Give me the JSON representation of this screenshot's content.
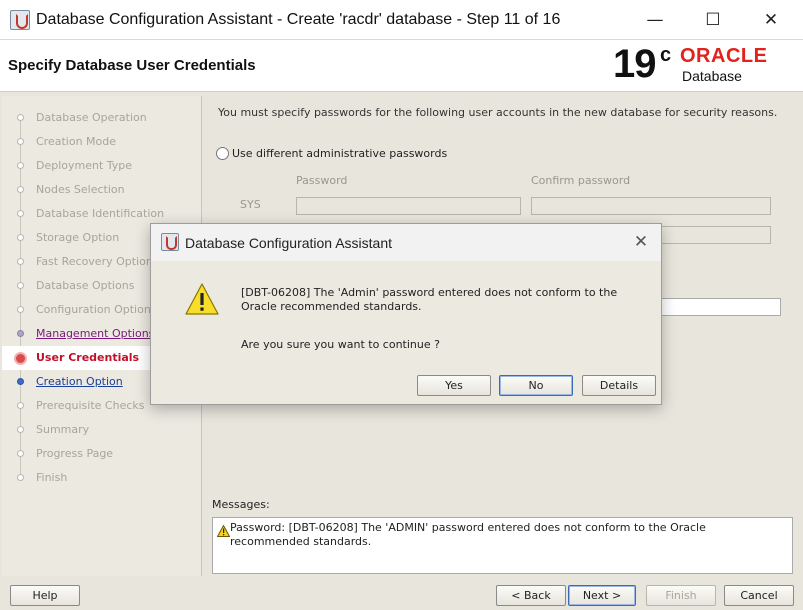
{
  "window": {
    "title": "Database Configuration Assistant - Create 'racdr' database - Step 11 of 16",
    "minimize": "—",
    "maximize": "☐",
    "close": "✕"
  },
  "header": {
    "page_title": "Specify Database User Credentials",
    "brand_version": "19",
    "brand_version_suffix": "c",
    "brand_name": "ORACLE",
    "brand_product": "Database"
  },
  "nav": {
    "steps": [
      {
        "label": "Database Operation",
        "state": "disabled"
      },
      {
        "label": "Creation Mode",
        "state": "disabled"
      },
      {
        "label": "Deployment Type",
        "state": "disabled"
      },
      {
        "label": "Nodes Selection",
        "state": "disabled"
      },
      {
        "label": "Database Identification",
        "state": "disabled"
      },
      {
        "label": "Storage Option",
        "state": "disabled"
      },
      {
        "label": "Fast Recovery Option",
        "state": "disabled"
      },
      {
        "label": "Database Options",
        "state": "disabled"
      },
      {
        "label": "Configuration Options",
        "state": "disabled"
      },
      {
        "label": "Management Options",
        "state": "done"
      },
      {
        "label": "User Credentials",
        "state": "current"
      },
      {
        "label": "Creation Option",
        "state": "next"
      },
      {
        "label": "Prerequisite Checks",
        "state": "disabled"
      },
      {
        "label": "Summary",
        "state": "disabled"
      },
      {
        "label": "Progress Page",
        "state": "disabled"
      },
      {
        "label": "Finish",
        "state": "disabled"
      }
    ]
  },
  "main": {
    "intro": "You must specify passwords for the following user accounts in the new database for security reasons.",
    "radio_different_label": "Use different administrative passwords",
    "col_password": "Password",
    "col_confirm": "Confirm password",
    "row_sys": "SYS",
    "messages_label": "Messages:",
    "message_text": "Password: [DBT-06208] The 'ADMIN' password entered does not conform to the Oracle recommended standards."
  },
  "buttons": {
    "help": "Help",
    "back": "< Back",
    "next": "Next >",
    "finish": "Finish",
    "cancel": "Cancel"
  },
  "dialog": {
    "title": "Database Configuration Assistant",
    "message": "[DBT-06208] The 'Admin' password entered does not conform to the Oracle recommended standards.",
    "question": "Are you sure you want to continue ?",
    "yes": "Yes",
    "no": "No",
    "details": "Details",
    "close": "✕"
  },
  "colors": {
    "brand_red": "#e3221b",
    "current_step": "#c0102a",
    "link_blue": "#1a3f9c"
  }
}
